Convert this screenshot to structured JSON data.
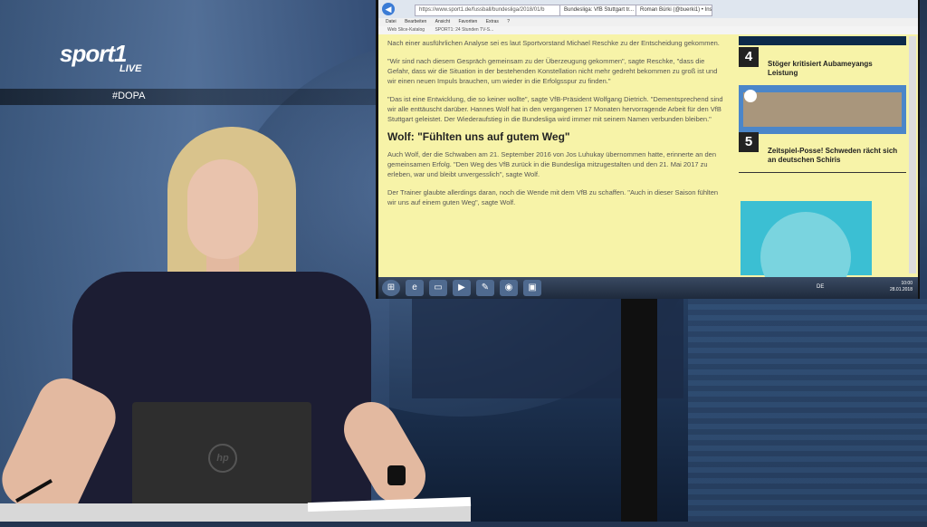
{
  "broadcast": {
    "channel_logo": "sport1",
    "live_label": "LIVE",
    "hashtag": "#DOPA"
  },
  "browser": {
    "url": "https://www.sport1.de/fussball/bundesliga/2018/01/b",
    "tabs": [
      "Bundesliga: VfB Stuttgart tr...",
      "Roman Bürki (@buerki1) • Insta..."
    ],
    "menu": [
      "Datei",
      "Bearbeiten",
      "Ansicht",
      "Favoriten",
      "Extras",
      "?"
    ],
    "favorites": [
      "Web Slice-Katalog",
      "SPORT1: 24 Stunden TV-S..."
    ]
  },
  "article": {
    "paragraphs": [
      "Nach einer ausführlichen Analyse sei es laut Sportvorstand Michael Reschke zu der Entscheidung gekommen.",
      "\"Wir sind nach diesem Gespräch gemeinsam zu der Überzeugung gekommen\", sagte Reschke, \"dass die Gefahr, dass wir die Situation in der bestehenden Konstellation nicht mehr gedreht bekommen zu groß ist und wir einen neuen Impuls brauchen, um wieder in die Erfolgsspur zu finden.\"",
      "\"Das ist eine Entwicklung, die so keiner wollte\", sagte VfB-Präsident Wolfgang Dietrich. \"Dementsprechend sind wir alle enttäuscht darüber. Hannes Wolf hat in den vergangenen 17 Monaten hervorragende Arbeit für den VfB Stuttgart geleistet. Der Wiederaufstieg in die Bundesliga wird immer mit seinem Namen verbunden bleiben.\""
    ],
    "heading": "Wolf: \"Fühlten uns auf gutem Weg\"",
    "paragraphs2": [
      "Auch Wolf, der die Schwaben am 21. September 2016 von Jos Luhukay übernommen hatte, erinnerte an den gemeinsamen Erfolg. \"Den Weg des VfB zurück in die Bundesliga mitzugestalten und den 21. Mai 2017 zu erleben, war und bleibt unvergesslich\", sagte Wolf.",
      "Der Trainer glaubte allerdings daran, noch die Wende mit dem VfB zu schaffen. \"Auch in dieser Saison fühlten wir uns auf einem guten Weg\", sagte Wolf."
    ]
  },
  "sidebar": {
    "items": [
      {
        "rank": "4",
        "title": "Stöger kritisiert Aubameyangs Leistung"
      },
      {
        "rank": "5",
        "title": "Zeitspiel-Posse! Schweden rächt sich an deutschen Schiris"
      }
    ]
  },
  "taskbar": {
    "lang": "DE",
    "time": "10:00",
    "date": "28.01.2018"
  },
  "laptop": {
    "brand": "hp"
  }
}
